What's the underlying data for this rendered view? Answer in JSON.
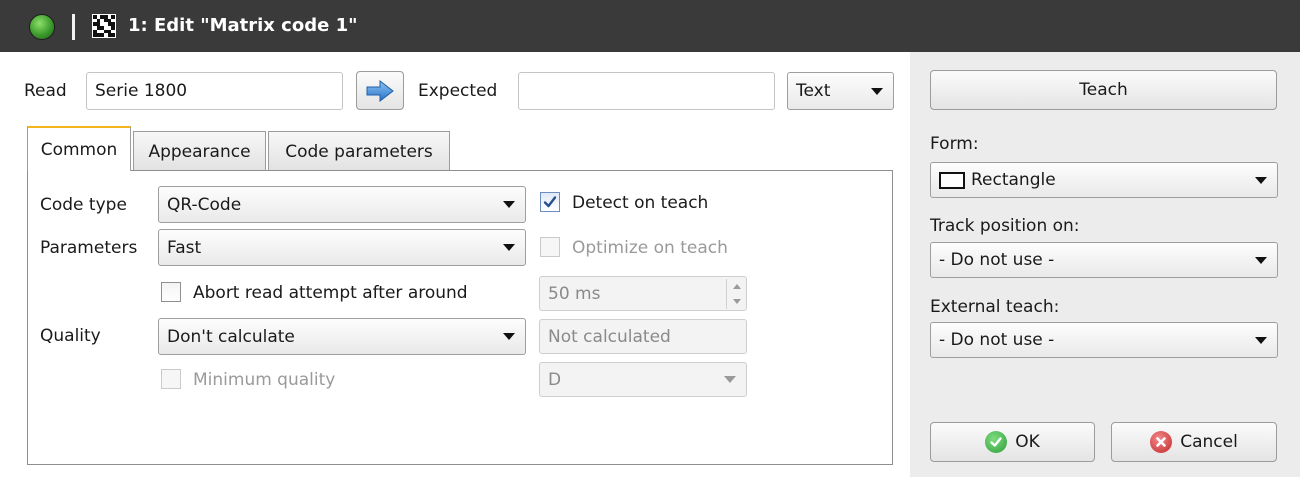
{
  "window": {
    "title": "1: Edit \"Matrix code 1\"",
    "status_color": "#3c9a2c"
  },
  "read_row": {
    "read_label": "Read",
    "read_value": "Serie 1800",
    "arrow_icon": "arrow-right-icon",
    "expected_label": "Expected",
    "expected_value": "",
    "format_select": "Text"
  },
  "tabs": [
    {
      "label": "Common",
      "active": true
    },
    {
      "label": "Appearance",
      "active": false
    },
    {
      "label": "Code parameters",
      "active": false
    }
  ],
  "common": {
    "code_type_label": "Code type",
    "code_type_value": "QR-Code",
    "detect_on_teach_label": "Detect on teach",
    "detect_on_teach_checked": true,
    "parameters_label": "Parameters",
    "parameters_value": "Fast",
    "optimize_on_teach_label": "Optimize on teach",
    "optimize_on_teach_checked": false,
    "abort_label": "Abort read attempt after around",
    "abort_checked": false,
    "abort_time_value": "50 ms",
    "quality_label": "Quality",
    "quality_value": "Don't calculate",
    "quality_result": "Not calculated",
    "minimum_quality_label": "Minimum quality",
    "minimum_quality_checked": false,
    "minimum_quality_value": "D"
  },
  "right": {
    "teach_button": "Teach",
    "form_label": "Form:",
    "form_value": "Rectangle",
    "form_icon": "rectangle-icon",
    "track_label": "Track position on:",
    "track_value": "- Do not use -",
    "external_label": "External teach:",
    "external_value": "- Do not use -",
    "ok_button": "OK",
    "cancel_button": "Cancel"
  },
  "colors": {
    "title_bar": "#3a3a3a",
    "active_tab_accent": "#f2b61c",
    "arrow_blue": "#3b86d6",
    "ok_green": "#2f9e3a",
    "cancel_red": "#c4262b"
  }
}
